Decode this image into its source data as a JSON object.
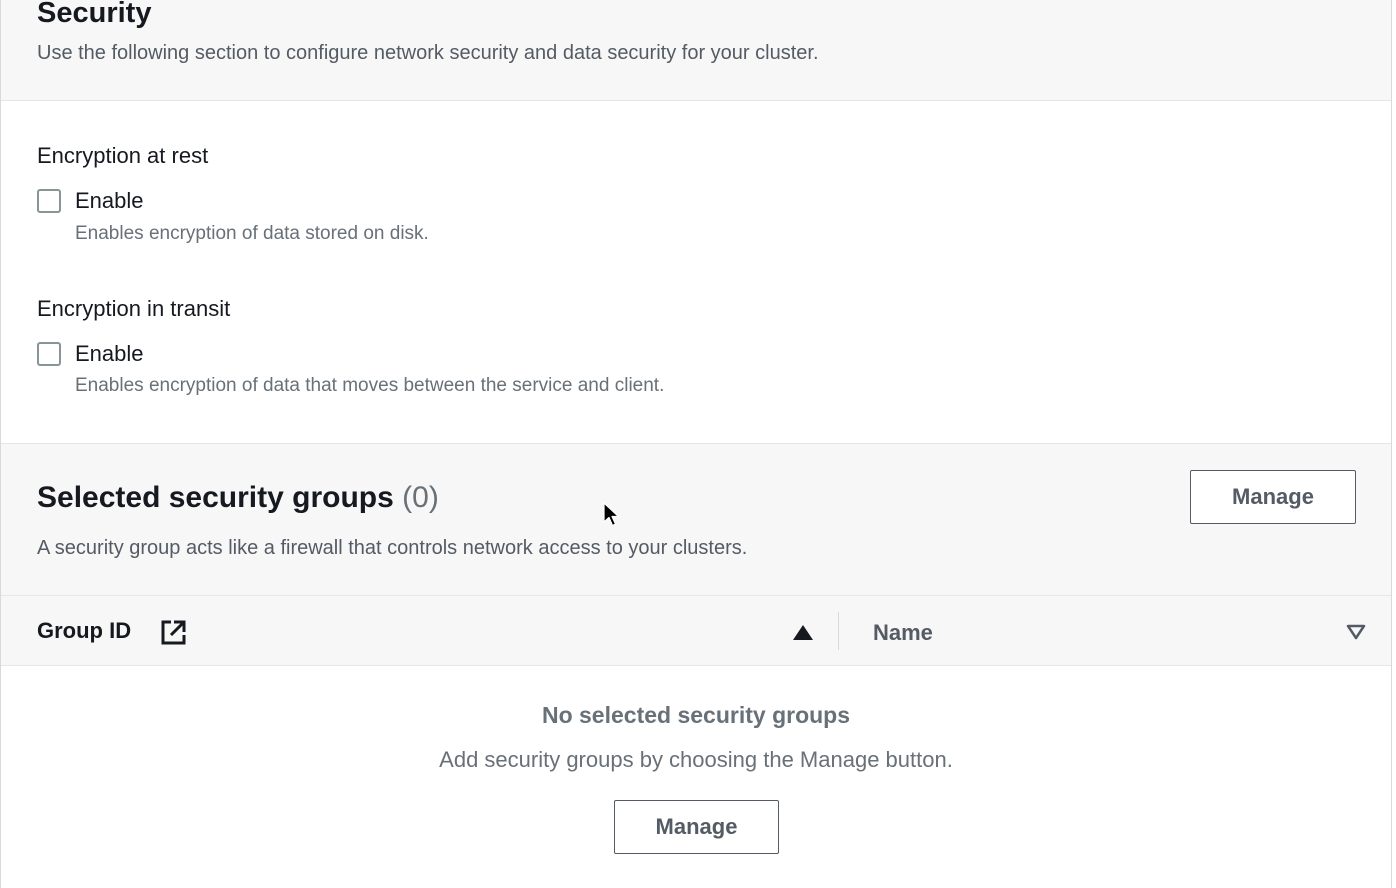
{
  "security": {
    "title": "Security",
    "description": "Use the following section to configure network security and data security for your cluster."
  },
  "encryption_at_rest": {
    "label": "Encryption at rest",
    "checkbox_label": "Enable",
    "checked": false,
    "description": "Enables encryption of data stored on disk."
  },
  "encryption_in_transit": {
    "label": "Encryption in transit",
    "checkbox_label": "Enable",
    "checked": false,
    "description": "Enables encryption of data that moves between the service and client."
  },
  "security_groups": {
    "title": "Selected security groups",
    "count": "(0)",
    "description": "A security group acts like a firewall that controls network access to your clusters.",
    "manage_label": "Manage",
    "table": {
      "columns": [
        {
          "label": "Group ID",
          "icon": "external-link-icon",
          "sort": "ascending"
        },
        {
          "label": "Name",
          "sort": "unsorted"
        }
      ],
      "rows": []
    },
    "empty_state": {
      "title": "No selected security groups",
      "description": "Add security groups by choosing the Manage button.",
      "button_label": "Manage"
    }
  },
  "colors": {
    "header_background": "#f7f7f7",
    "border": "#e4e7e7",
    "text_primary": "#16191f",
    "text_secondary": "#687078",
    "button_border": "#545b64"
  }
}
